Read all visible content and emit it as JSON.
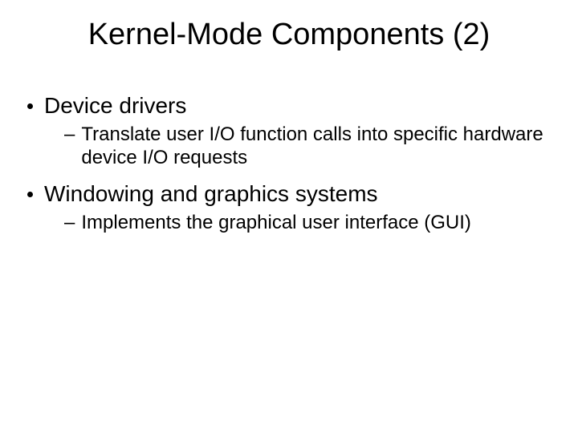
{
  "title": "Kernel-Mode Components (2)",
  "bullets": {
    "b1": "Device drivers",
    "b1_1": "Translate user I/O function calls into specific hardware device I/O requests",
    "b2": "Windowing and graphics systems",
    "b2_1": "Implements the graphical user interface (GUI)"
  }
}
